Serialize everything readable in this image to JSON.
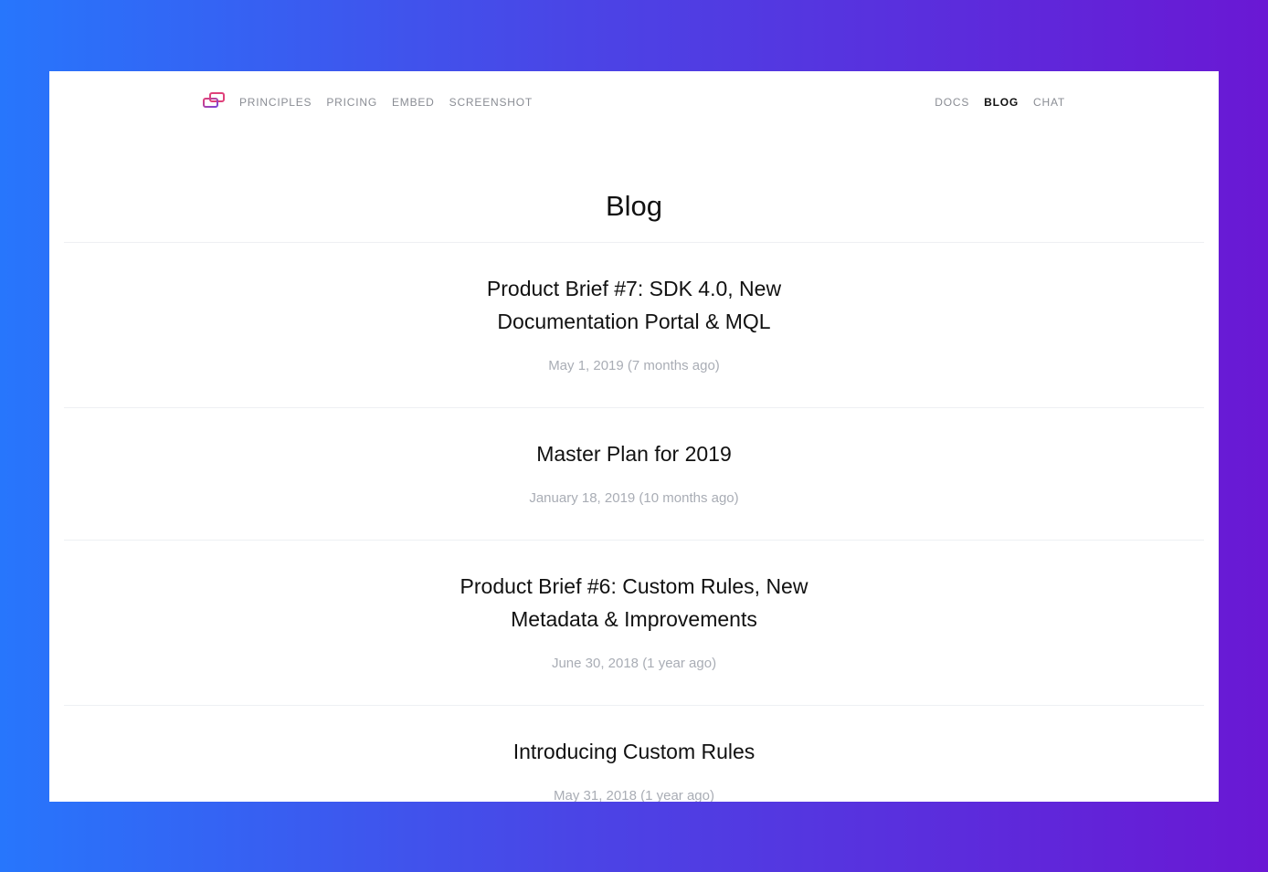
{
  "nav": {
    "logo_icon": "overlapping-rectangles-logo",
    "left_links": [
      "PRINCIPLES",
      "PRICING",
      "EMBED",
      "SCREENSHOT"
    ],
    "right_links": [
      "DOCS",
      "BLOG",
      "CHAT"
    ],
    "active": "BLOG"
  },
  "page": {
    "title": "Blog"
  },
  "posts": [
    {
      "title": "Product Brief #7: SDK 4.0, New Documentation Portal & MQL",
      "date": "May 1, 2019 (7 months ago)"
    },
    {
      "title": "Master Plan for 2019",
      "date": "January 18, 2019 (10 months ago)"
    },
    {
      "title": "Product Brief #6: Custom Rules, New Metadata & Improvements",
      "date": "June 30, 2018 (1 year ago)"
    },
    {
      "title": "Introducing Custom Rules",
      "date": "May 31, 2018 (1 year ago)"
    }
  ],
  "colors": {
    "background_gradient_start": "#2776fc",
    "background_gradient_end": "#6a18d4",
    "logo_pink": "#e0417a",
    "logo_purple": "#7a44d8",
    "text": "#111111",
    "muted": "#a9adb5"
  }
}
